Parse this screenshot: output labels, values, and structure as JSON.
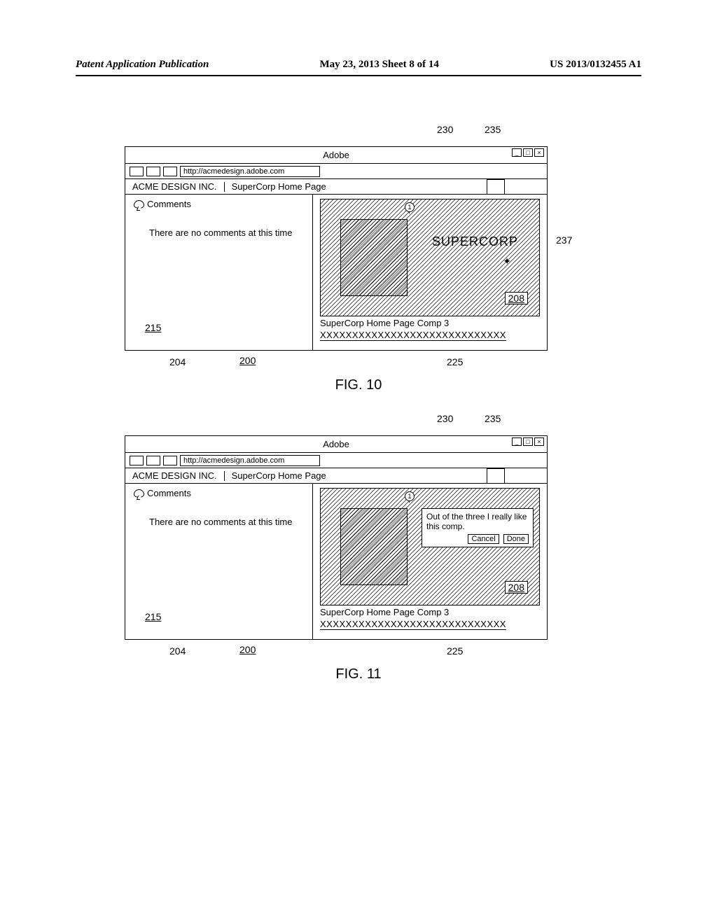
{
  "header": {
    "left": "Patent Application Publication",
    "center": "May 23, 2013  Sheet 8 of 14",
    "right": "US 2013/0132455 A1"
  },
  "shared": {
    "win_title": "Adobe",
    "url": "http://acmedesign.adobe.com",
    "breadcrumb1": "ACME DESIGN INC.",
    "breadcrumb2": "SuperCorp Home Page",
    "comments_label": "Comments",
    "no_comments": "There are no comments at this time",
    "supercorp": "SUPERCORP",
    "comp_title": "SuperCorp Home Page Comp 3",
    "xrow": "XXXXXXXXXXXXXXXXXXXXXXXXXXXXX",
    "ref215": "215",
    "ref208": "208",
    "ref200": "200",
    "ref204": "204",
    "ref225": "225",
    "ref230": "230",
    "ref235": "235",
    "ref237": "237",
    "pin_num": "1"
  },
  "fig10": {
    "caption": "FIG. 10"
  },
  "fig11": {
    "caption": "FIG. 11",
    "popup_text": "Out of the three I really like this comp.",
    "cancel": "Cancel",
    "done": "Done"
  }
}
